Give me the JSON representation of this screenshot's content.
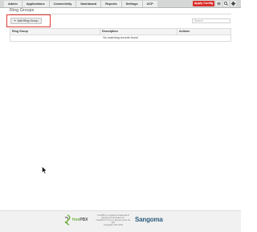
{
  "navbar": {
    "tabs": [
      "Admin",
      "Applications",
      "Connectivity",
      "Dashboard",
      "Reports",
      "Settings",
      "UCP"
    ],
    "apply_config_label": "Apply Config",
    "icons": [
      "menu-icon",
      "search-icon",
      "gear-icon"
    ]
  },
  "page": {
    "title": "Ring Groups"
  },
  "toolbar": {
    "add_button_icon": "+",
    "add_button_label": "Add Ring Group",
    "search_placeholder": "Search"
  },
  "table": {
    "columns": [
      "Ring Group",
      "Description",
      "Actions"
    ],
    "empty_message": "No matching records found"
  },
  "footer": {
    "freepbx_free": "free",
    "freepbx_pbx": "PBX",
    "info_lines": [
      "FreePBX is a registered trademark of",
      "Sangoma Technologies Inc.",
      "FreePBX 17.0.19.x is licensed under the",
      "GPL",
      "Copyright© 2007-2024"
    ],
    "sangoma_label": "Sangoma"
  },
  "colors": {
    "apply_button": "#d92c28",
    "highlight_box": "#e03a34",
    "freepbx_green": "#6dae3d",
    "sangoma_blue": "#2c5d7e"
  }
}
